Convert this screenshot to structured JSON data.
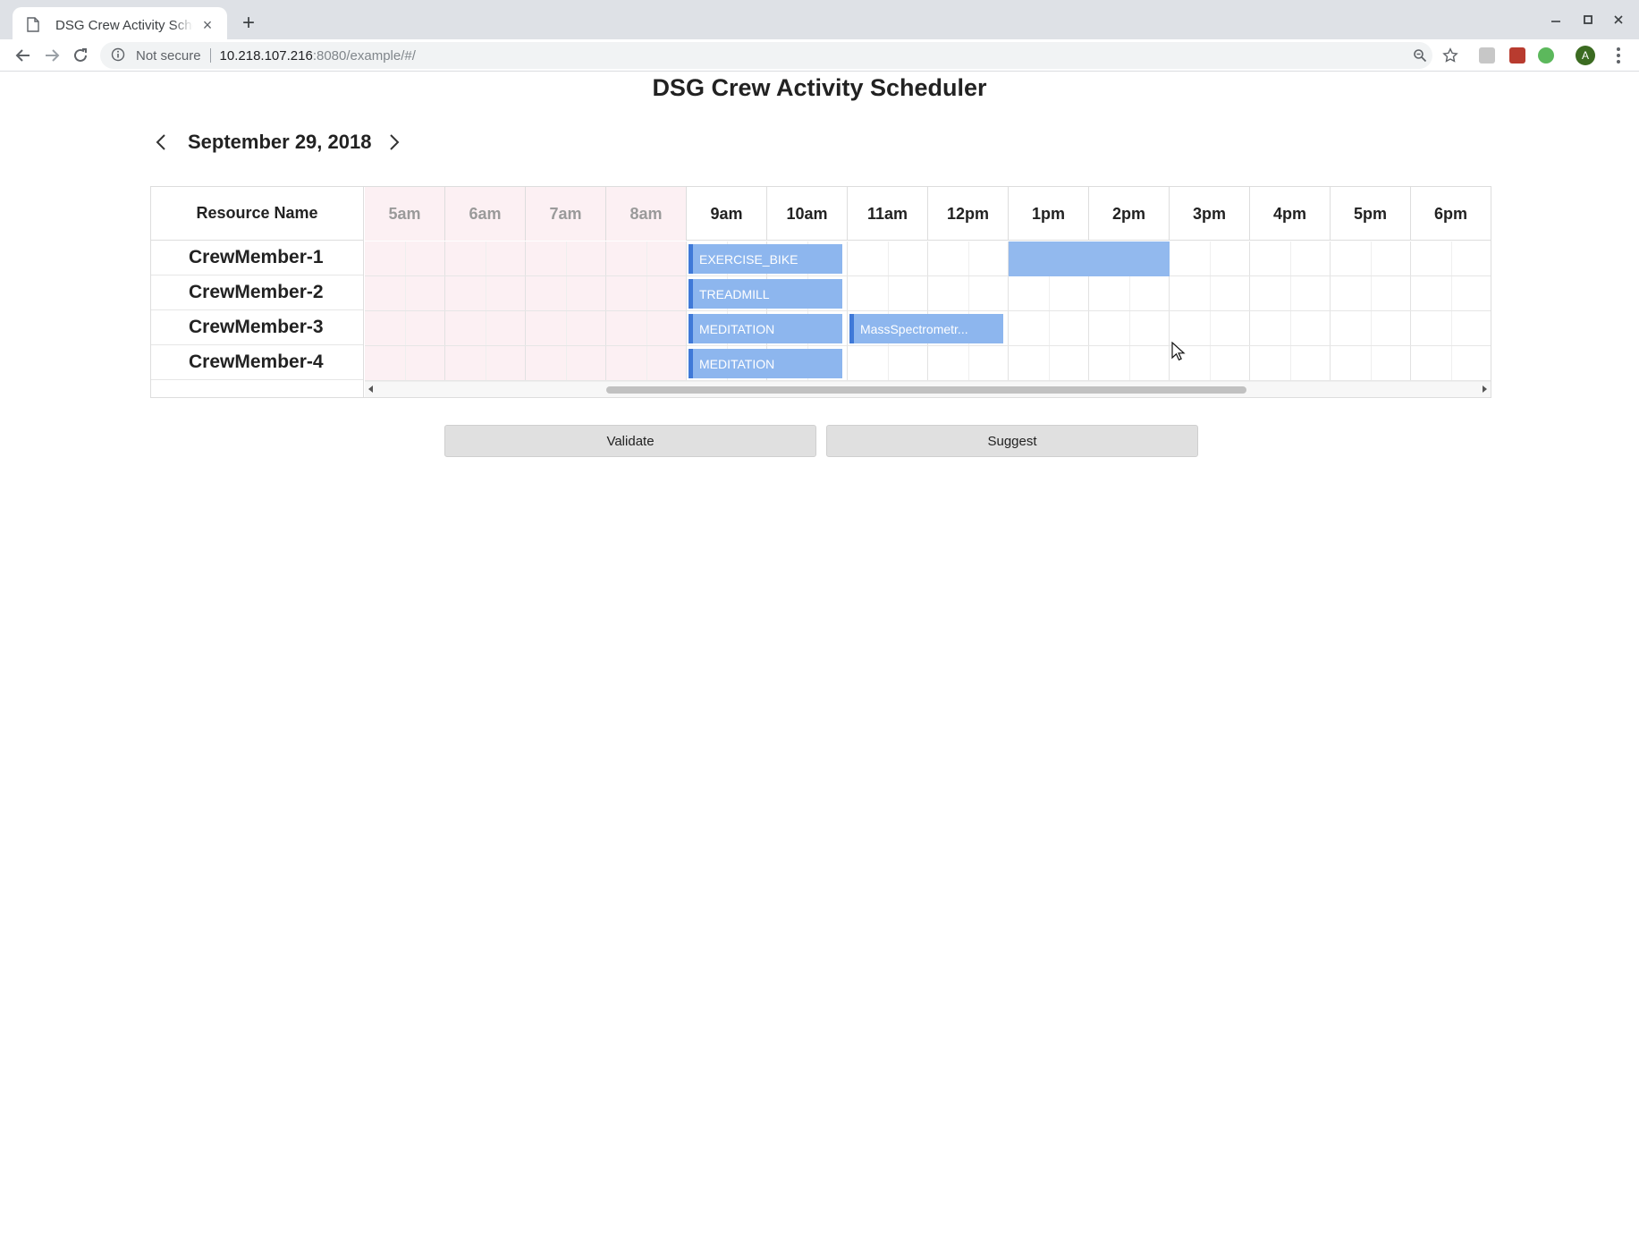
{
  "browser": {
    "tab_title": "DSG Crew Activity Scheduler",
    "security_label": "Not secure",
    "url_host": "10.218.107.216",
    "url_path": ":8080/example/#/",
    "profile_initial": "A"
  },
  "page": {
    "title": "DSG Crew Activity Scheduler",
    "date": "September 29, 2018"
  },
  "scheduler": {
    "resource_header": "Resource Name",
    "hours": [
      "5am",
      "6am",
      "7am",
      "8am",
      "9am",
      "10am",
      "11am",
      "12pm",
      "1pm",
      "2pm",
      "3pm",
      "4pm",
      "5pm",
      "6pm"
    ],
    "non_business_hours": [
      "5am",
      "6am",
      "7am",
      "8am"
    ],
    "resources": [
      "CrewMember-1",
      "CrewMember-2",
      "CrewMember-3",
      "CrewMember-4"
    ],
    "events": [
      {
        "resource": "CrewMember-1",
        "title": "EXERCISE_BIKE",
        "start": "9am",
        "end": "11am"
      },
      {
        "resource": "CrewMember-2",
        "title": "TREADMILL",
        "start": "9am",
        "end": "11am"
      },
      {
        "resource": "CrewMember-3",
        "title": "MEDITATION",
        "start": "9am",
        "end": "11am"
      },
      {
        "resource": "CrewMember-3",
        "title": "MassSpectrometr...",
        "start": "11am",
        "end": "1pm"
      },
      {
        "resource": "CrewMember-4",
        "title": "MEDITATION",
        "start": "9am",
        "end": "11am"
      }
    ],
    "selection": {
      "resource": "CrewMember-1",
      "start": "1pm",
      "end": "3pm"
    }
  },
  "buttons": {
    "validate": "Validate",
    "suggest": "Suggest"
  },
  "colors": {
    "event_fill": "#8db6ee",
    "event_accent": "#3f79d8",
    "off_hours": "#fcf0f3"
  }
}
